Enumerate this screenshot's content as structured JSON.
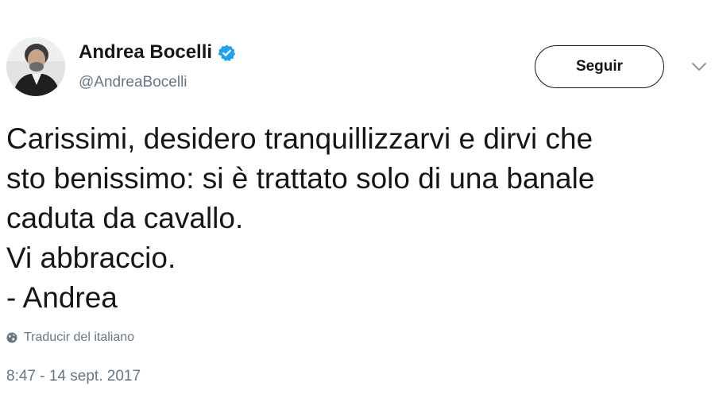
{
  "author": {
    "display_name": "Andrea Bocelli",
    "handle": "@AndreaBocelli",
    "verified": true,
    "verified_icon": "verified-badge-icon",
    "avatar_icon": "profile-avatar"
  },
  "actions": {
    "follow_label": "Seguir",
    "more_menu_icon": "chevron-down-icon"
  },
  "tweet": {
    "lines": [
      "Carissimi, desidero tranquillizzarvi e dirvi che",
      "sto benissimo: si è trattato solo di una banale",
      "caduta da cavallo.",
      "Vi abbraccio.",
      "- Andrea"
    ],
    "translate_label": "Traducir del italiano",
    "translate_icon": "globe-icon",
    "timestamp": "8:47 - 14 sept. 2017"
  },
  "colors": {
    "text_primary": "#14171a",
    "text_secondary": "#657786",
    "verified_blue": "#1da1f2",
    "background": "#ffffff"
  }
}
